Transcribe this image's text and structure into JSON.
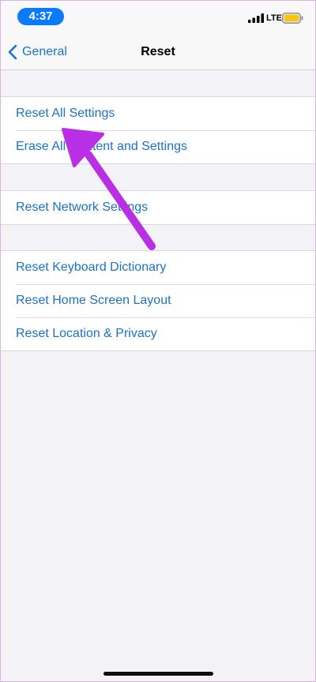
{
  "status_bar": {
    "time": "4:37",
    "network": "LTE",
    "accent_color": "#0a7aff",
    "battery_color": "#f5c518"
  },
  "nav": {
    "back_label": "General",
    "title": "Reset"
  },
  "groups": [
    {
      "items": [
        "Reset All Settings",
        "Erase All Content and Settings"
      ]
    },
    {
      "items": [
        "Reset Network Settings"
      ]
    },
    {
      "items": [
        "Reset Keyboard Dictionary",
        "Reset Home Screen Layout",
        "Reset Location & Privacy"
      ]
    }
  ],
  "annotation": {
    "type": "arrow",
    "color": "#b92fe3",
    "points_to": "Reset All Settings"
  },
  "text_color": "#1a73c4"
}
